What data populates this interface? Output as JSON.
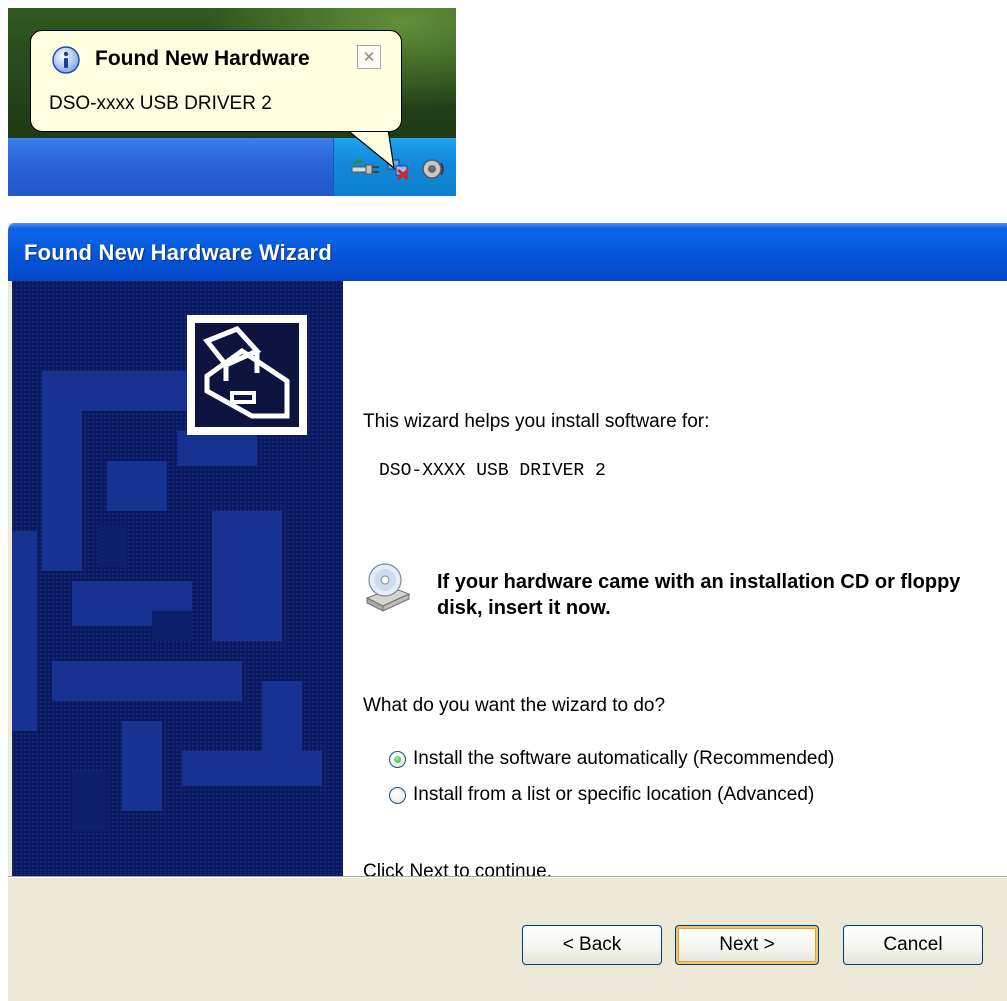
{
  "balloon": {
    "title": "Found New Hardware",
    "message": "DSO-xxxx USB DRIVER 2",
    "close_glyph": "✕",
    "icon": "info-icon"
  },
  "tray": {
    "icons": [
      "safely-remove-hardware-icon",
      "network-disconnected-icon",
      "speaker-icon"
    ]
  },
  "wizard": {
    "title": "Found New Hardware Wizard",
    "intro": "This wizard helps you install software for:",
    "device_name": "DSO-XXXX USB DRIVER 2",
    "cd_message": "If your hardware came with an installation CD or floppy disk, insert it now.",
    "question": "What do you want the wizard to do?",
    "options": [
      {
        "label": "Install the software automatically (Recommended)",
        "selected": true
      },
      {
        "label": "Install from a list or specific location (Advanced)",
        "selected": false
      }
    ],
    "continue_text": "Click Next to continue.",
    "buttons": {
      "back": "< Back",
      "next": "Next >",
      "cancel": "Cancel"
    }
  },
  "colors": {
    "title_bar": "#0553d8",
    "balloon_bg": "#ffffe1",
    "button_face": "#ece9d8",
    "side_art": "#0a1a55"
  }
}
